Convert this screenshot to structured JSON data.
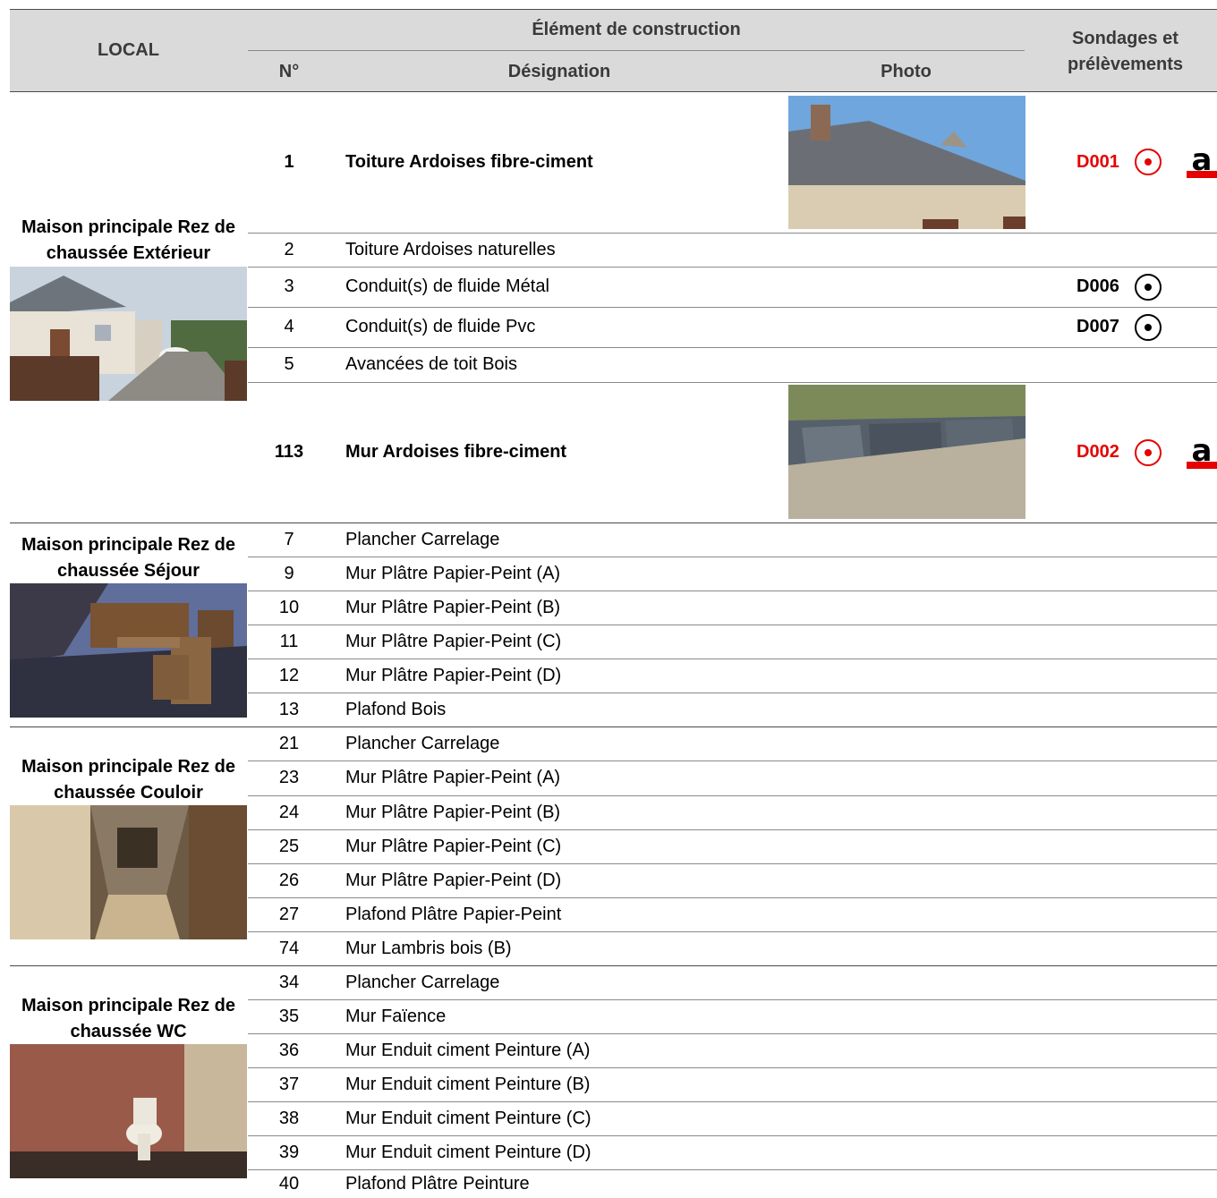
{
  "header": {
    "local": "LOCAL",
    "element": "Élément de construction",
    "num": "N°",
    "designation": "Désignation",
    "photo": "Photo",
    "sondages": "Sondages et prélèvements"
  },
  "colors": {
    "header_bg": "#dadada",
    "red_code": "#e60000",
    "black_code": "#000000"
  },
  "locals": [
    {
      "label": "Maison principale Rez de chaussée Extérieur",
      "photo_desc": "street-house-photo",
      "rows": [
        {
          "num": "1",
          "designation": "Toiture Ardoises fibre-ciment",
          "bold": true,
          "photo": "roof-photo",
          "code": "D001",
          "code_color": "red",
          "icons": [
            "target-red-icon",
            "asbestos-a-icon"
          ]
        },
        {
          "num": "2",
          "designation": "Toiture Ardoises naturelles"
        },
        {
          "num": "3",
          "designation": "Conduit(s) de fluide Métal",
          "code": "D006",
          "code_color": "black",
          "icons": [
            "target-black-icon"
          ]
        },
        {
          "num": "4",
          "designation": "Conduit(s) de fluide Pvc",
          "code": "D007",
          "code_color": "black",
          "icons": [
            "target-black-icon"
          ]
        },
        {
          "num": "5",
          "designation": "Avancées de toit Bois"
        },
        {
          "num": "113",
          "designation": "Mur Ardoises fibre-ciment",
          "bold": true,
          "photo": "wall-slate-photo",
          "code": "D002",
          "code_color": "red",
          "icons": [
            "target-red-icon",
            "asbestos-a-icon"
          ]
        }
      ]
    },
    {
      "label": "Maison principale Rez de chaussée Séjour",
      "rows": [
        {
          "num": "7",
          "designation": "Plancher Carrelage"
        },
        {
          "num": "9",
          "designation": "Mur Plâtre Papier-Peint (A)"
        },
        {
          "num": "10",
          "designation": "Mur Plâtre Papier-Peint (B)"
        },
        {
          "num": "11",
          "designation": "Mur Plâtre Papier-Peint (C)"
        },
        {
          "num": "12",
          "designation": "Mur Plâtre Papier-Peint (D)"
        },
        {
          "num": "13",
          "designation": "Plafond Bois"
        }
      ]
    },
    {
      "label": "Maison principale Rez de chaussée Couloir",
      "rows": [
        {
          "num": "21",
          "designation": "Plancher Carrelage"
        },
        {
          "num": "23",
          "designation": "Mur Plâtre Papier-Peint (A)"
        },
        {
          "num": "24",
          "designation": "Mur Plâtre Papier-Peint (B)"
        },
        {
          "num": "25",
          "designation": "Mur Plâtre Papier-Peint (C)"
        },
        {
          "num": "26",
          "designation": "Mur Plâtre Papier-Peint (D)"
        },
        {
          "num": "27",
          "designation": "Plafond Plâtre Papier-Peint"
        },
        {
          "num": "74",
          "designation": "Mur Lambris bois (B)"
        }
      ]
    },
    {
      "label": "Maison principale Rez de chaussée WC",
      "rows": [
        {
          "num": "34",
          "designation": "Plancher Carrelage"
        },
        {
          "num": "35",
          "designation": "Mur Faïence"
        },
        {
          "num": "36",
          "designation": "Mur Enduit ciment Peinture (A)"
        },
        {
          "num": "37",
          "designation": "Mur Enduit ciment Peinture (B)"
        },
        {
          "num": "38",
          "designation": "Mur Enduit ciment Peinture (C)"
        },
        {
          "num": "39",
          "designation": "Mur Enduit ciment Peinture (D)"
        },
        {
          "num": "40",
          "designation": "Plafond Plâtre Peinture"
        }
      ]
    }
  ]
}
